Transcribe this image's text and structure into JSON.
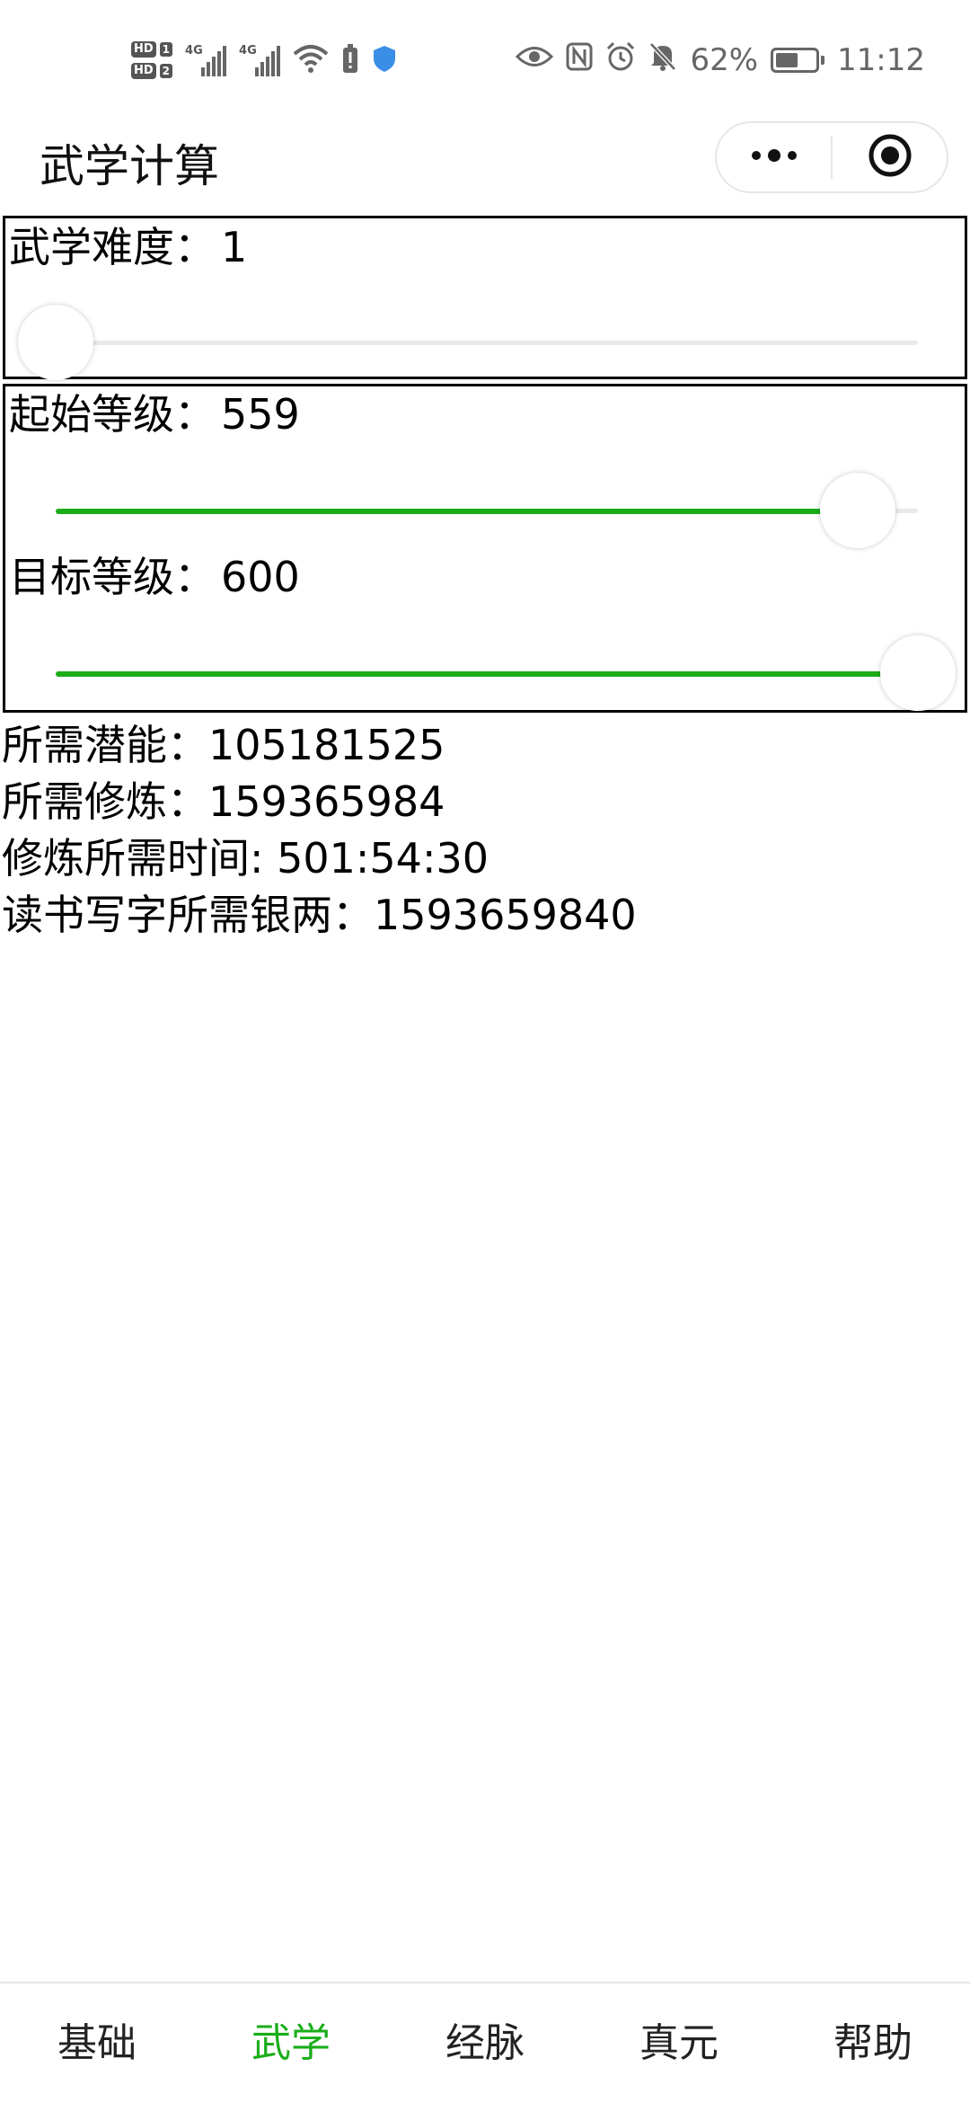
{
  "status_bar": {
    "left_badges": [
      "HD",
      "1",
      "HD",
      "2"
    ],
    "network_tags": [
      "4G",
      "4G"
    ],
    "battery_text": "62%",
    "battery_level": 0.62,
    "time": "11:12",
    "icons": [
      "eye-icon",
      "nfc-icon",
      "alarm-icon",
      "mute-icon"
    ]
  },
  "nav": {
    "title": "武学计算",
    "more_icon": "more-dots-icon",
    "close_icon": "target-icon"
  },
  "difficulty": {
    "label": "武学难度：",
    "value": "1",
    "min": 1,
    "max": 30,
    "position": 0
  },
  "start_level": {
    "label": "起始等级：",
    "value": "559",
    "position": 0.93
  },
  "target_level": {
    "label": "目标等级：",
    "value": "600",
    "position": 1.0
  },
  "results": {
    "potential": "所需潜能：105181525",
    "training": "所需修炼：159365984",
    "time": "修炼所需时间: 501:54:30",
    "silver": "读书写字所需银两：1593659840"
  },
  "tabs": [
    {
      "label": "基础",
      "active": false
    },
    {
      "label": "武学",
      "active": true
    },
    {
      "label": "经脉",
      "active": false
    },
    {
      "label": "真元",
      "active": false
    },
    {
      "label": "帮助",
      "active": false
    }
  ],
  "colors": {
    "accent": "#1aad19",
    "track": "#e9e9e9"
  }
}
